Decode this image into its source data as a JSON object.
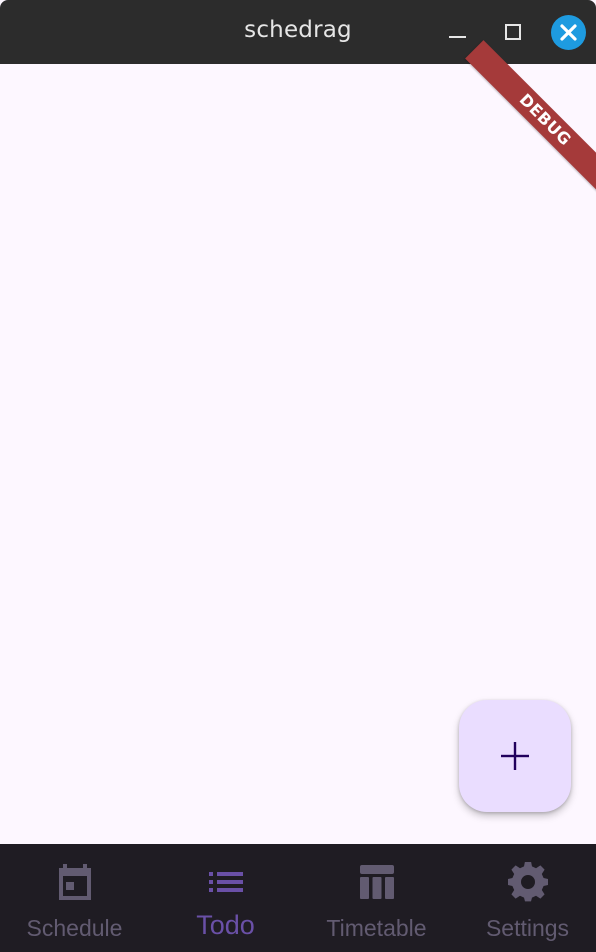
{
  "window": {
    "title": "schedrag",
    "controls": {
      "minimize_icon": "minimize-icon",
      "maximize_icon": "maximize-icon",
      "close_icon": "close-icon"
    }
  },
  "debug_banner": {
    "label": "DEBUG",
    "color": "#a53a3a"
  },
  "fab": {
    "icon": "plus-icon",
    "background": "#eaddff",
    "icon_color": "#21005d"
  },
  "bottom_nav": {
    "active_index": 1,
    "items": [
      {
        "label": "Schedule",
        "icon": "calendar-today-icon"
      },
      {
        "label": "Todo",
        "icon": "list-icon"
      },
      {
        "label": "Timetable",
        "icon": "table-icon"
      },
      {
        "label": "Settings",
        "icon": "gear-icon"
      }
    ],
    "colors": {
      "background": "#1f1c23",
      "inactive": "#625b71",
      "active": "#6a50a7"
    }
  },
  "colors": {
    "surface": "#fdf7ff",
    "titlebar": "#2c2c2c",
    "close_button": "#1e9be0"
  }
}
